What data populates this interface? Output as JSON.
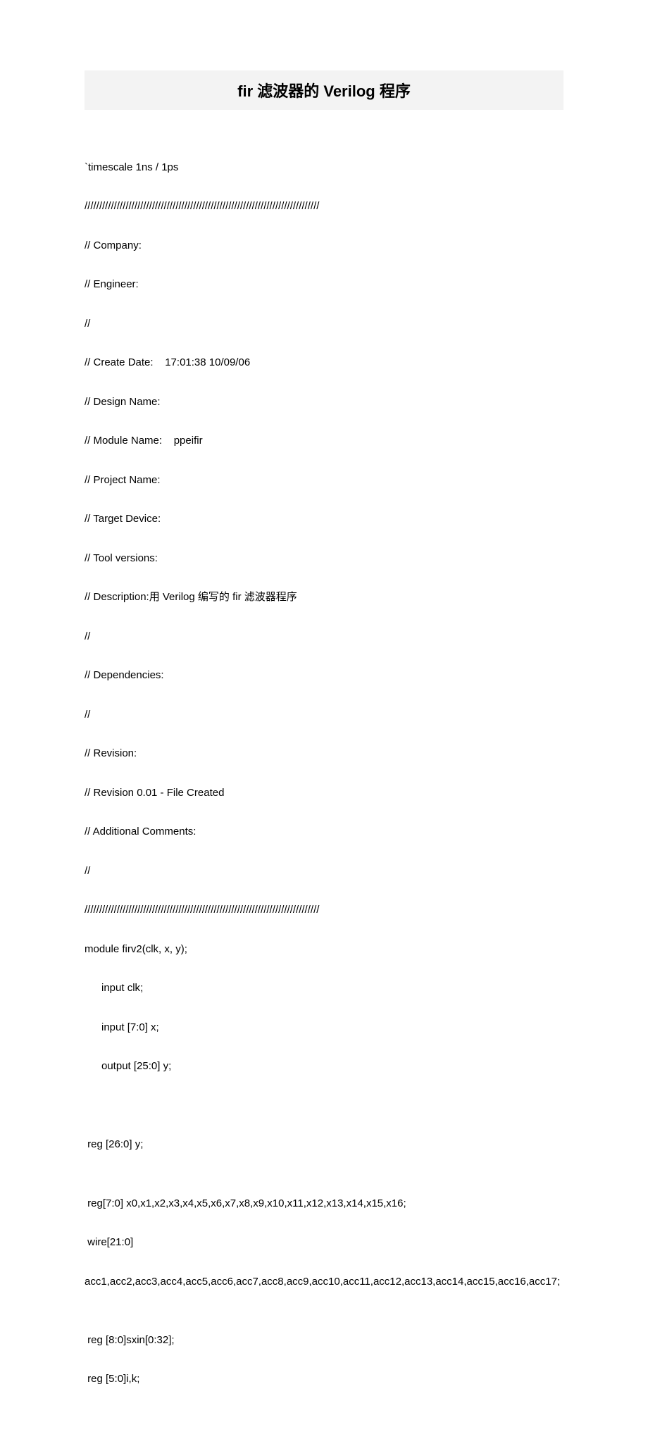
{
  "title": "fir 滤波器的 Verilog 程序",
  "code": {
    "lines": [
      "`timescale 1ns / 1ps",
      "////////////////////////////////////////////////////////////////////////////////",
      "// Company:",
      "// Engineer:",
      "//",
      "// Create Date:    17:01:38 10/09/06",
      "// Design Name:",
      "// Module Name:    ppeifir",
      "// Project Name:",
      "// Target Device:",
      "// Tool versions:",
      "// Description:用 Verilog 编写的 fir 滤波器程序",
      "//",
      "// Dependencies:",
      "//",
      "// Revision:",
      "// Revision 0.01 - File Created",
      "// Additional Comments:",
      "//",
      "////////////////////////////////////////////////////////////////////////////////",
      "module firv2(clk, x, y);"
    ],
    "indent_lines": [
      "input clk;",
      "input [7:0] x;",
      "output [25:0] y;"
    ],
    "lines2": [
      "",
      "",
      " reg [26:0] y;",
      "",
      " reg[7:0] x0,x1,x2,x3,x4,x5,x6,x7,x8,x9,x10,x11,x12,x13,x14,x15,x16;",
      " wire[21:0]",
      "acc1,acc2,acc3,acc4,acc5,acc6,acc7,acc8,acc9,acc10,acc11,acc12,acc13,acc14,acc15,acc16,acc17;",
      "",
      " reg [8:0]sxin[0:32];",
      " reg [5:0]i,k;"
    ]
  }
}
